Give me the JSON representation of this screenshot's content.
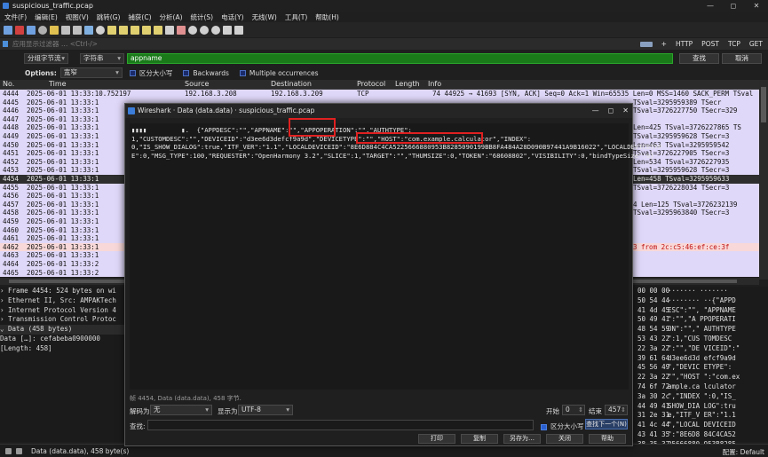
{
  "window": {
    "title": "suspicious_traffic.pcap",
    "controls": [
      "—",
      "◻",
      "✕"
    ]
  },
  "menu": [
    "文件(F)",
    "编辑(E)",
    "视图(V)",
    "跳转(G)",
    "捕获(C)",
    "分析(A)",
    "统计(S)",
    "电话(Y)",
    "无线(W)",
    "工具(T)",
    "帮助(H)"
  ],
  "filter": {
    "placeholder": "应用显示过滤器 … <Ctrl-/>",
    "buttons": [
      "+",
      "HTTP",
      "POST",
      "TCP",
      "GET"
    ]
  },
  "search": {
    "scope": "分组字节流",
    "type": "字符串",
    "value": "appname",
    "find_label": "查找",
    "cancel_label": "取消"
  },
  "options": {
    "label": "Options:",
    "width": "宽窄",
    "case": "区分大小写",
    "backwards": "Backwards",
    "multiple": "Multiple occurrences"
  },
  "columns": {
    "no": "No.",
    "time": "Time",
    "source": "Source",
    "destination": "Destination",
    "protocol": "Protocol",
    "length": "Length",
    "info": "Info"
  },
  "packets": [
    {
      "no": "4444",
      "time": "2025-06-01 13:33:10.752197",
      "src": "192.168.3.208",
      "dst": "192.168.3.209",
      "proto": "TCP",
      "info": "74 44925 → 41693 [SYN, ACK] Seq=0 Ack=1 Win=65535 Len=0 MSS=1460 SACK_PERM TSval",
      "tail": "",
      "color": "#e0d8f8"
    },
    {
      "no": "4445",
      "time": "2025-06-01 13:33:1",
      "src": "",
      "dst": "",
      "proto": "",
      "info": "",
      "tail": "TSval=3295959389 TSecr",
      "color": "#e0d8f8"
    },
    {
      "no": "4446",
      "time": "2025-06-01 13:33:1",
      "src": "",
      "dst": "",
      "proto": "",
      "info": "",
      "tail": "TSval=3726227750 TSecr=329",
      "color": "#e0d8f8"
    },
    {
      "no": "4447",
      "time": "2025-06-01 13:33:1",
      "src": "",
      "dst": "",
      "proto": "",
      "info": "",
      "tail": "",
      "color": "#e0d8f8"
    },
    {
      "no": "4448",
      "time": "2025-06-01 13:33:1",
      "src": "",
      "dst": "",
      "proto": "",
      "info": "",
      "tail": "Len=425 TSval=3726227865 TS",
      "color": "#e0d8f8"
    },
    {
      "no": "4449",
      "time": "2025-06-01 13:33:1",
      "src": "",
      "dst": "",
      "proto": "",
      "info": "",
      "tail": "TSval=3295959628 TSecr=3",
      "color": "#e0d8f8"
    },
    {
      "no": "4450",
      "time": "2025-06-01 13:33:1",
      "src": "",
      "dst": "",
      "proto": "",
      "info": "",
      "tail": "Len=463 TSval=3295959542",
      "color": "#e0d8f8"
    },
    {
      "no": "4451",
      "time": "2025-06-01 13:33:1",
      "src": "",
      "dst": "",
      "proto": "",
      "info": "",
      "tail": "TSval=3726227905 TSecr=3",
      "color": "#e0d8f8"
    },
    {
      "no": "4452",
      "time": "2025-06-01 13:33:1",
      "src": "",
      "dst": "",
      "proto": "",
      "info": "",
      "tail": "Len=534 TSval=3726227935",
      "color": "#e0d8f8"
    },
    {
      "no": "4453",
      "time": "2025-06-01 13:33:1",
      "src": "",
      "dst": "",
      "proto": "",
      "info": "",
      "tail": "TSval=3295959628 TSecr=3",
      "color": "#e0d8f8"
    },
    {
      "no": "4454",
      "time": "2025-06-01 13:33:1",
      "src": "",
      "dst": "",
      "proto": "",
      "info": "",
      "tail": "Len=458 TSval=3295959633",
      "color": "#2e2e2e",
      "selected": true
    },
    {
      "no": "4455",
      "time": "2025-06-01 13:33:1",
      "src": "",
      "dst": "",
      "proto": "",
      "info": "",
      "tail": "TSval=3726228034 TSecr=3",
      "color": "#e0d8f8"
    },
    {
      "no": "4456",
      "time": "2025-06-01 13:33:1",
      "src": "",
      "dst": "",
      "proto": "",
      "info": "",
      "tail": "",
      "color": "#e0d8f8"
    },
    {
      "no": "4457",
      "time": "2025-06-01 13:33:1",
      "src": "",
      "dst": "",
      "proto": "",
      "info": "",
      "tail": "4 Len=125 TSval=3726232139",
      "color": "#e0d8f8"
    },
    {
      "no": "4458",
      "time": "2025-06-01 13:33:1",
      "src": "",
      "dst": "",
      "proto": "",
      "info": "",
      "tail": "TSval=3295963840 TSecr=3",
      "color": "#e0d8f8"
    },
    {
      "no": "4459",
      "time": "2025-06-01 13:33:1",
      "src": "",
      "dst": "",
      "proto": "",
      "info": "",
      "tail": "",
      "color": "#e0d8f8"
    },
    {
      "no": "4460",
      "time": "2025-06-01 13:33:1",
      "src": "",
      "dst": "",
      "proto": "",
      "info": "",
      "tail": "",
      "color": "#e0d8f8"
    },
    {
      "no": "4461",
      "time": "2025-06-01 13:33:1",
      "src": "",
      "dst": "",
      "proto": "",
      "info": "",
      "tail": "",
      "color": "#e0d8f8"
    },
    {
      "no": "4462",
      "time": "2025-06-01 13:33:1",
      "src": "",
      "dst": "",
      "proto": "",
      "info": "",
      "tail": "3 from 2c:c5:46:ef:ce:3f",
      "color": "#f8d8d8",
      "tail_color": "#c01010"
    },
    {
      "no": "4463",
      "time": "2025-06-01 13:33:1",
      "src": "",
      "dst": "",
      "proto": "",
      "info": "",
      "tail": "",
      "color": "#e0d8f8"
    },
    {
      "no": "4464",
      "time": "2025-06-01 13:33:2",
      "src": "",
      "dst": "",
      "proto": "",
      "info": "",
      "tail": "",
      "color": "#e0d8f8"
    },
    {
      "no": "4465",
      "time": "2025-06-01 13:33:2",
      "src": "",
      "dst": "",
      "proto": "",
      "info": "",
      "tail": "",
      "color": "#e0d8f8"
    }
  ],
  "details": [
    {
      "text": "› Frame 4454: 524 bytes on wi"
    },
    {
      "text": "› Ethernet II, Src: AMPAKTech"
    },
    {
      "text": "› Internet Protocol Version 4"
    },
    {
      "text": "› Transmission Control Protoc"
    },
    {
      "text": "⌄ Data (458 bytes)"
    },
    {
      "text": "    Data […]: cefabeba0900000"
    },
    {
      "text": "    [Length: 458]"
    }
  ],
  "bytes": [
    {
      "hex": "00 00 00",
      "ascii": "·······  ·······"
    },
    {
      "hex": "50 54 44",
      "ascii": "········ ··{\"APPD"
    },
    {
      "hex": "41 4d 45",
      "ascii": "ESC\":\"\", \"APPNAME"
    },
    {
      "hex": "50 49 41",
      "ascii": "\":\"\",\"A PPOPERATI"
    },
    {
      "hex": "48 54 59",
      "ascii": "ON\":\"\",\" AUTHTYPE"
    },
    {
      "hex": "53 43 22",
      "ascii": "\":1,\"CUS TOMDESC"
    },
    {
      "hex": "22 3a 22",
      "ascii": "\":\"\",\"DE VICEID\":\""
    },
    {
      "hex": "39 61 64",
      "ascii": "d3ee6d3d efcf9a9d"
    },
    {
      "hex": "45 56 49",
      "ascii": "\",\"DEVIC ETYPE\":"
    },
    {
      "hex": "22 3a 22",
      "ascii": "\"\",\"HOST \":\"com.ex"
    },
    {
      "hex": "74 6f 72",
      "ascii": "ample.ca lculator"
    },
    {
      "hex": "3a 30 2c",
      "ascii": "\",\"INDEX \":0,\"IS_"
    },
    {
      "hex": "44 49 41",
      "ascii": "SHOW_DIA LOG\":tru"
    },
    {
      "hex": "31 2e 31",
      "ascii": "e,\"ITF_V ER\":\"1.1"
    },
    {
      "hex": "41 4c 44",
      "ascii": "\",\"LOCAL DEVICEID"
    },
    {
      "hex": "43 41 35",
      "ascii": "\":\"8E6D8 84C4CA52"
    },
    {
      "hex": "38 35 32",
      "ascii": "25666880 953B8285"
    }
  ],
  "status": {
    "left": "Data (data.data), 458 byte(s)",
    "profile_label": "配置:",
    "profile": "Default"
  },
  "dialog": {
    "title": "Wireshark · Data (data.data) · suspicious_traffic.pcap",
    "lines": [
      "▮▮▮▮         ▮.  {\"APPDESC\":\"\",\"APPNAME\":\"\",\"APPOPERATION\":\"\",\"AUTHTYPE\":",
      "1,\"CUSTOMDESC\":\"\",\"DEVICEID\":\"d3ee6d3defcf9a9d\",\"DEVICETYPE\":\"\",\"HOST\":\"com.example.calculator\",\"INDEX\":",
      "0,\"IS_SHOW_DIALOG\":true,\"ITF_VER\":\"1.1\",\"LOCALDEVICEID\":\"8E6D884C4CA5225666880953B8285090199BB8FA484A28D090B97441A9B16022\",\"LOCALDEVICETYP",
      "E\":0,\"MSG_TYPE\":100,\"REQUESTER\":\"OpenHarmony 3.2\",\"SLICE\":1,\"TARGET\":\"\",\"THUMSIZE\":0,\"TOKEN\":\"68608802\",\"VISIBILITY\":0,\"bindTypeSize\":0}"
    ],
    "summary": "帧 4454, Data (data.data), 458 字节.",
    "decode_label": "解码为",
    "decode_value": "无",
    "show_label": "显示为",
    "show_value": "UTF-8",
    "start_label": "开始",
    "start_value": "0",
    "end_label": "结束",
    "end_value": "457",
    "find_label": "查找:",
    "case_label": "区分大小写",
    "find_next": "查找下一个(N)",
    "print": "打印",
    "copy": "复制",
    "save_as": "另存为…",
    "close": "关闭",
    "help": "帮助",
    "controls": [
      "—",
      "◻",
      "✕"
    ]
  },
  "colors": {
    "accent": "#1a7a1a",
    "highlight": "#e02020",
    "row_default": "#e0d8f8"
  }
}
